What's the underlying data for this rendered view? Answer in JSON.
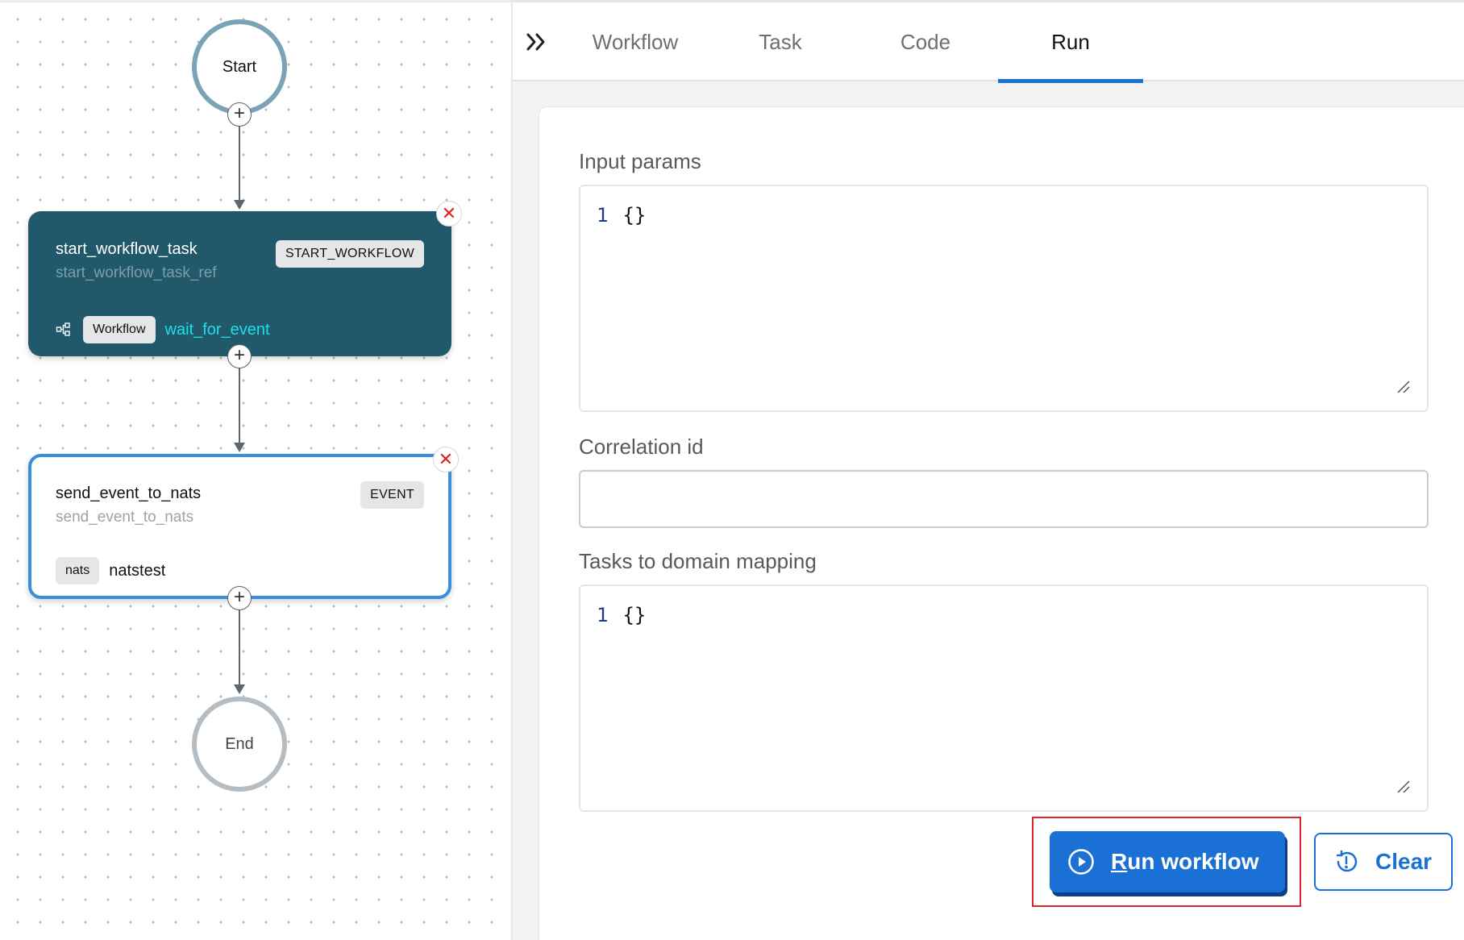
{
  "canvas": {
    "start_label": "Start",
    "end_label": "End",
    "plus_symbol": "+",
    "close_symbol": "✕",
    "tasks": [
      {
        "name": "start_workflow_task",
        "ref": "start_workflow_task_ref",
        "type": "START_WORKFLOW",
        "sub_icon": "subworkflow-icon",
        "sub_badge": "Workflow",
        "sub_value": "wait_for_event"
      },
      {
        "name": "send_event_to_nats",
        "ref": "send_event_to_nats",
        "type": "EVENT",
        "sub_badge": "nats",
        "sub_value": "natstest"
      }
    ]
  },
  "panel": {
    "collapse_icon": "double-chevron-right-icon",
    "tabs": [
      {
        "label": "Workflow",
        "active": false
      },
      {
        "label": "Task",
        "active": false
      },
      {
        "label": "Code",
        "active": false
      },
      {
        "label": "Run",
        "active": true
      }
    ],
    "form": {
      "input_params": {
        "label": "Input params",
        "line_number": "1",
        "value": "{}"
      },
      "correlation_id": {
        "label": "Correlation id",
        "value": ""
      },
      "task_domain_mapping": {
        "label": "Tasks to domain mapping",
        "line_number": "1",
        "value": "{}"
      }
    },
    "actions": {
      "run": {
        "accel": "R",
        "label_rest": "un workflow",
        "icon": "play-circle-icon"
      },
      "clear": {
        "label": "Clear",
        "icon": "history-reset-icon"
      }
    }
  },
  "colors": {
    "accent": "#1a70d4",
    "dark_card": "#21586a",
    "link": "#1ce0e8",
    "selected_border": "#3b8ed9",
    "highlight": "#e0242a"
  }
}
